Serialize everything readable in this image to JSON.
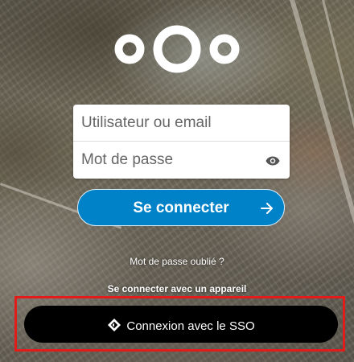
{
  "logo": {
    "icon": "nextcloud-logo",
    "color": "#ffffff"
  },
  "login": {
    "username_placeholder": "Utilisateur ou email",
    "password_placeholder": "Mot de passe",
    "password_toggle_icon": "eye-icon",
    "submit_label": "Se connecter",
    "submit_icon": "arrow-right-icon",
    "submit_color": "#0082c9"
  },
  "links": {
    "forgot_password": "Mot de passe oublié ?",
    "device_login": "Se connecter avec un appareil"
  },
  "sso": {
    "label": "Connexion avec le SSO",
    "icon": "key-diamond-icon",
    "background": "#000000",
    "highlight_color": "#e21b1b"
  }
}
